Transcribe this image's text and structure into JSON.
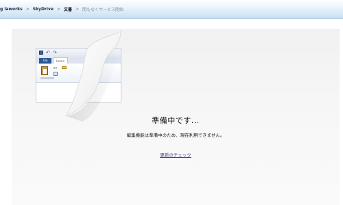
{
  "breadcrumb": {
    "items": [
      {
        "label": "g laworks"
      },
      {
        "label": "SkyDrive"
      },
      {
        "label": "文書"
      },
      {
        "label": "間もなくサービス開始"
      }
    ],
    "separator": ">"
  },
  "mock_window": {
    "qat": {
      "save_icon": "save-icon",
      "undo_icon": "undo-icon",
      "redo_icon": "redo-icon"
    },
    "tabs": [
      {
        "label": "File"
      },
      {
        "label": "Home"
      }
    ],
    "icons": [
      "paste-icon",
      "cut-icon",
      "copy-icon",
      "format-painter-icon"
    ]
  },
  "message": {
    "title": "準備中です...",
    "body": "編集機能は準備中のため、現在利用できません。",
    "link": "更新のチェック"
  },
  "colors": {
    "header_top": "#ffffff",
    "header_bottom": "#c6dff3",
    "canvas": "#f4f4f4",
    "link": "#4b3a8f",
    "file_tab": "#2b5797"
  }
}
